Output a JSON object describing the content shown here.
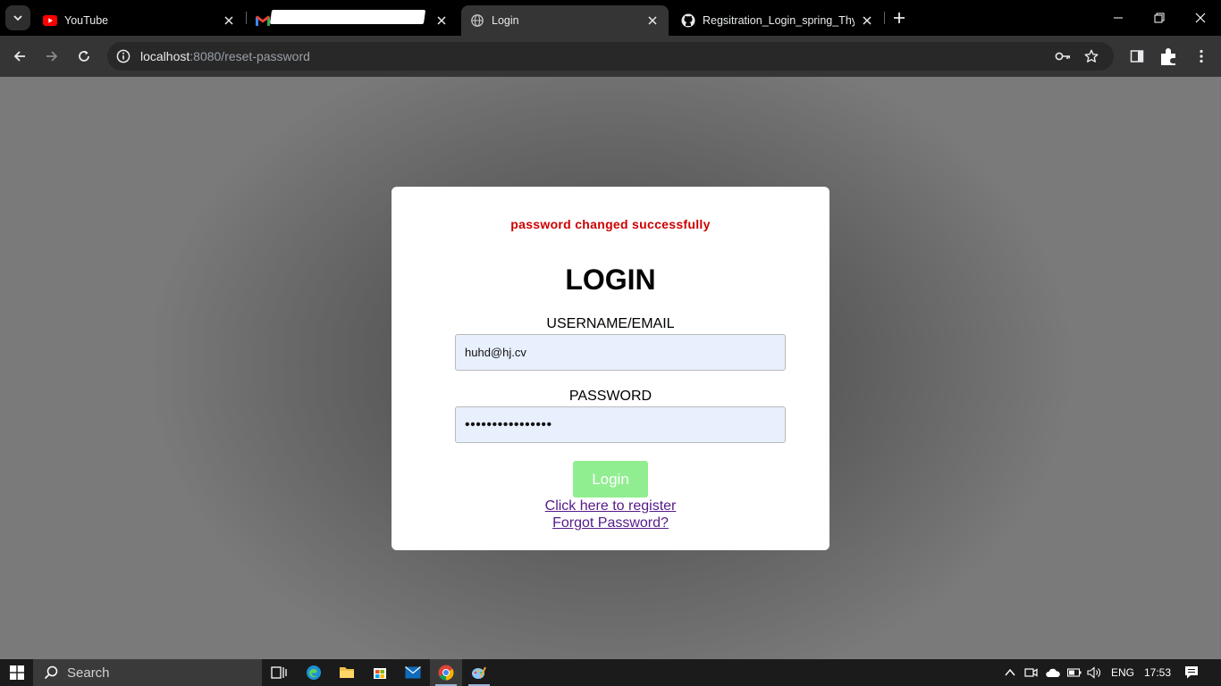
{
  "browser": {
    "tabs": [
      {
        "title": "YouTube",
        "favicon": "youtube-icon",
        "active": false
      },
      {
        "title": "",
        "favicon": "gmail-icon",
        "active": false
      },
      {
        "title": "Login",
        "favicon": "globe-icon",
        "active": true
      },
      {
        "title": "Regsitration_Login_spring_Thym",
        "favicon": "github-icon",
        "active": false
      }
    ],
    "address": {
      "host": "localhost",
      "path": ":8080/reset-password"
    }
  },
  "page": {
    "success_message": "password changed successfully",
    "heading": "LOGIN",
    "username_label": "USERNAME/EMAIL",
    "username_value": "huhd@hj.cv",
    "password_label": "PASSWORD",
    "password_value": "••••••••••••••••",
    "login_button": "Login",
    "register_link": "Click here to register",
    "forgot_link": "Forgot Password?"
  },
  "taskbar": {
    "search_placeholder": "Search",
    "language": "ENG",
    "time": "17:53"
  },
  "colors": {
    "success": "#cc0000",
    "button": "#90ee90",
    "input_bg": "#e8f0fe",
    "link": "#551a8b"
  }
}
